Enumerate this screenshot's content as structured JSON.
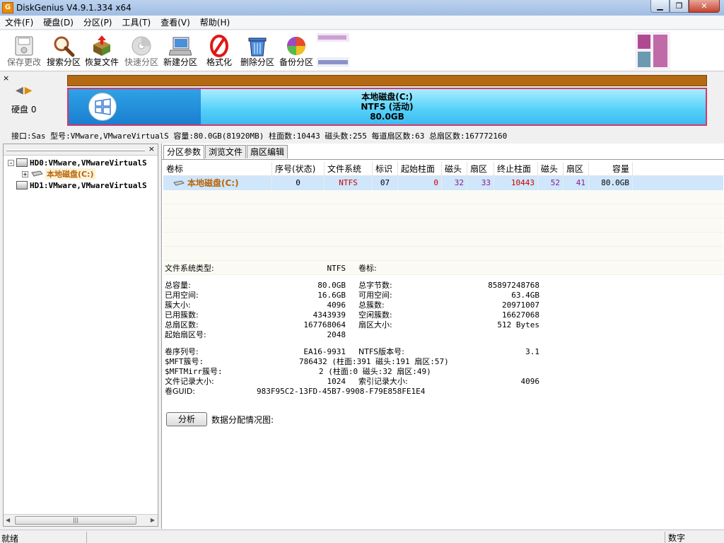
{
  "window": {
    "title": "DiskGenius V4.9.1.334 x64",
    "icon_letter": "G",
    "min": "▁",
    "max": "❐",
    "close": "✕"
  },
  "menu": [
    "文件(F)",
    "硬盘(D)",
    "分区(P)",
    "工具(T)",
    "查看(V)",
    "帮助(H)"
  ],
  "toolbar": [
    {
      "label": "保存更改",
      "icon": "save-disk-icon",
      "enabled": false
    },
    {
      "label": "搜索分区",
      "icon": "magnifier-icon",
      "enabled": true
    },
    {
      "label": "恢复文件",
      "icon": "recover-box-icon",
      "enabled": true
    },
    {
      "label": "快速分区",
      "icon": "quick-partition-disc-icon",
      "enabled": false
    },
    {
      "label": "新建分区",
      "icon": "new-partition-computer-icon",
      "enabled": true
    },
    {
      "label": "格式化",
      "icon": "format-prohibit-icon",
      "enabled": true
    },
    {
      "label": "删除分区",
      "icon": "trash-can-icon",
      "enabled": true
    },
    {
      "label": "备份分区",
      "icon": "backup-pie-icon",
      "enabled": true
    }
  ],
  "disk_bar": {
    "close": "×",
    "disk_label": "硬盘 0",
    "partition_name": "本地磁盘(C:)",
    "partition_fs": "NTFS (活动)",
    "partition_size": "80.0GB",
    "used_fraction": 0.207,
    "info": "接口:Sas  型号:VMware,VMwareVirtualS  容量:80.0GB(81920MB)  柱面数:10443  磁头数:255  每道扇区数:63  总扇区数:167772160"
  },
  "tree": {
    "close": "×",
    "items": [
      {
        "label": "HD0:VMware,VMwareVirtualS",
        "level": 0,
        "expander": "-"
      },
      {
        "label": "本地磁盘(C:)",
        "level": 1,
        "expander": "+"
      },
      {
        "label": "HD1:VMware,VMwareVirtualS",
        "level": 0,
        "expander": ""
      }
    ],
    "scroll_left": "◀",
    "scroll_right": "▶",
    "scroll_grip": "|||"
  },
  "tabs": [
    "分区参数",
    "浏览文件",
    "扇区编辑"
  ],
  "partition_table": {
    "columns": [
      "卷标",
      "序号(状态)",
      "文件系统",
      "标识",
      "起始柱面",
      "磁头",
      "扇区",
      "终止柱面",
      "磁头",
      "扇区",
      "容量"
    ],
    "rows": [
      [
        "本地磁盘(C:)",
        "0",
        "NTFS",
        "07",
        "0",
        "32",
        "33",
        "10443",
        "52",
        "41",
        "80.0GB"
      ]
    ]
  },
  "fs_info": {
    "type_label": "文件系统类型:",
    "type_value": "NTFS",
    "vol_label": "卷标:",
    "left": [
      [
        "总容量:",
        "80.0GB"
      ],
      [
        "已用空间:",
        "16.6GB"
      ],
      [
        "簇大小:",
        "4096"
      ],
      [
        "已用簇数:",
        "4343939"
      ],
      [
        "总扇区数:",
        "167768064"
      ],
      [
        "起始扇区号:",
        "2048"
      ]
    ],
    "right": [
      [
        "总字节数:",
        "85897248768"
      ],
      [
        "可用空间:",
        "63.4GB"
      ],
      [
        "总簇数:",
        "20971007"
      ],
      [
        "空闲簇数:",
        "16627068"
      ],
      [
        "扇区大小:",
        "512 Bytes"
      ]
    ],
    "serial_label": "卷序列号:",
    "serial_value": "EA16-9931",
    "ntfs_ver_label": "NTFS版本号:",
    "ntfs_ver_value": "3.1",
    "mft_label": "$MFT簇号:",
    "mft_value": "786432 (柱面:391 磁头:191 扇区:57)",
    "mftmirr_label": "$MFTMirr簇号:",
    "mftmirr_value": "2 (柱面:0 磁头:32 扇区:49)",
    "filerec_label": "文件记录大小:",
    "filerec_value": "1024",
    "indexrec_label": "索引记录大小:",
    "indexrec_value": "4096",
    "guid_label": "卷GUID:",
    "guid_value": "983F95C2-13FD-45B7-9908-F79E858FE1E4"
  },
  "analyze_button": "分析",
  "distribution_label": "数据分配情况图:",
  "status": {
    "text": "就绪",
    "num": "数字"
  },
  "colors": {
    "partition_border": "#d4386a",
    "disk_header": "#b36a12",
    "selected_row": "#cfe6fb",
    "ntfs_red": "#cc0000",
    "value_blue": "#1a1aa0"
  }
}
